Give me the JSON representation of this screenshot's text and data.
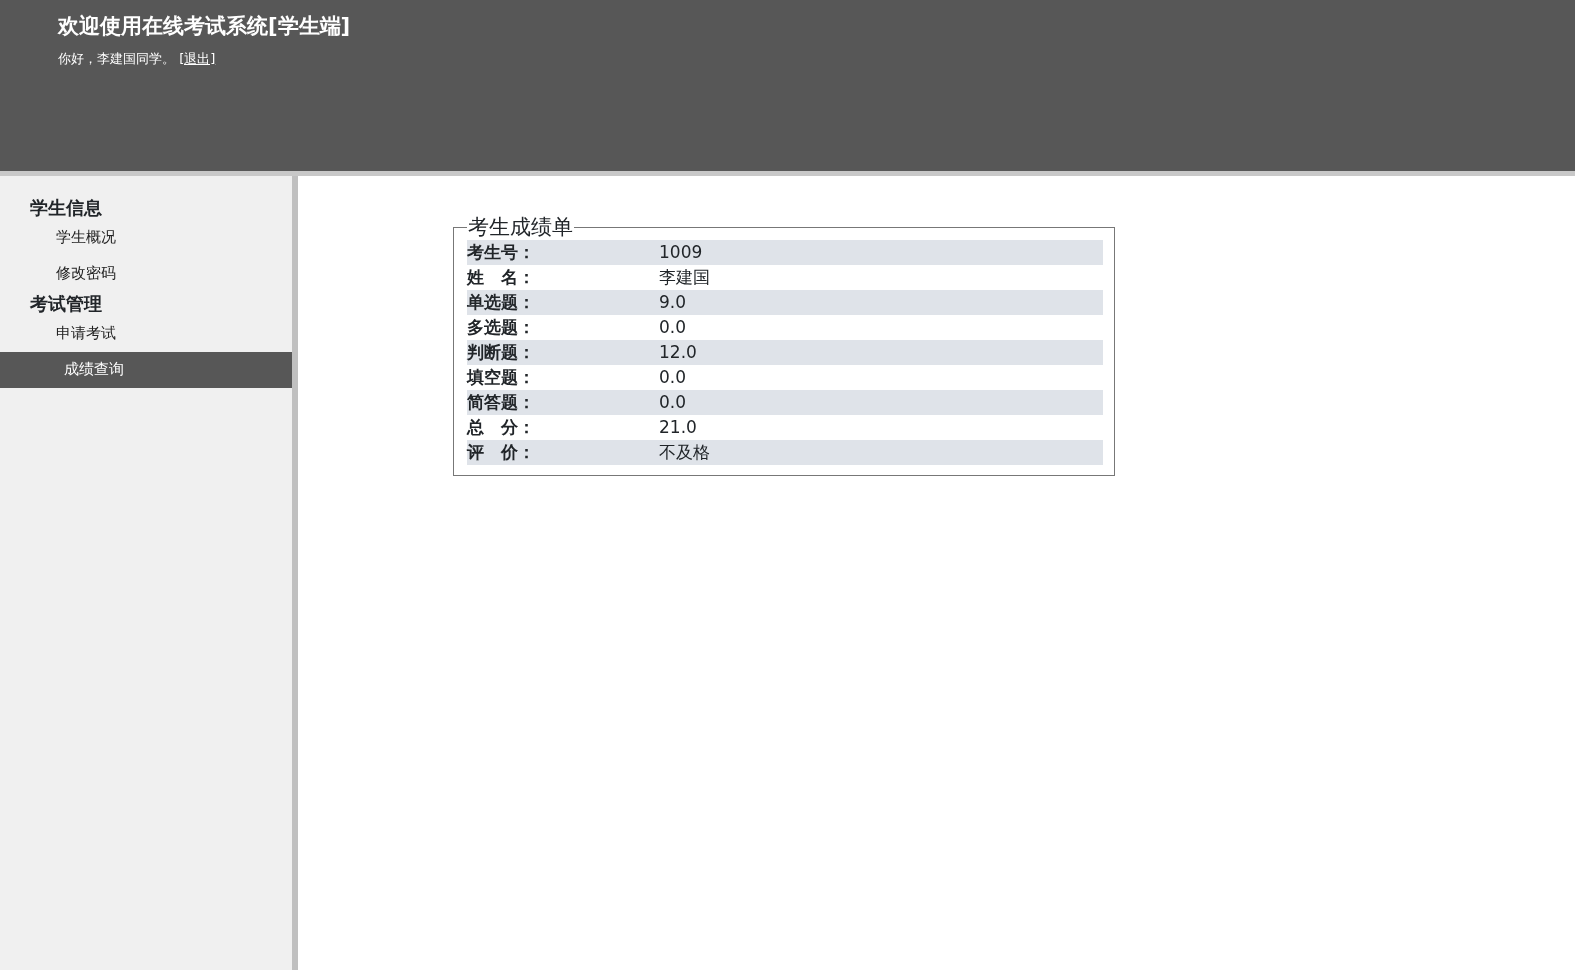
{
  "header": {
    "title": "欢迎使用在线考试系统[学生端]",
    "greeting": "你好，李建国同学。",
    "logout_link": "[退出]"
  },
  "sidebar": {
    "groups": [
      {
        "title": "学生信息",
        "items": [
          {
            "label": "学生概况",
            "selected": false
          },
          {
            "label": "修改密码",
            "selected": false
          }
        ]
      },
      {
        "title": "考试管理",
        "items": [
          {
            "label": "申请考试",
            "selected": false
          },
          {
            "label": "成绩查询",
            "selected": true
          }
        ]
      }
    ]
  },
  "score_sheet": {
    "legend": "考生成绩单",
    "rows": [
      {
        "label": "考生号：",
        "value": "1009"
      },
      {
        "label": "姓　名：",
        "value": "李建国"
      },
      {
        "label": "单选题：",
        "value": "9.0"
      },
      {
        "label": "多选题：",
        "value": "0.0"
      },
      {
        "label": "判断题：",
        "value": "12.0"
      },
      {
        "label": "填空题：",
        "value": "0.0"
      },
      {
        "label": "简答题：",
        "value": "0.0"
      },
      {
        "label": "总　分：",
        "value": "21.0"
      },
      {
        "label": "评　价：",
        "value": "不及格"
      }
    ]
  }
}
